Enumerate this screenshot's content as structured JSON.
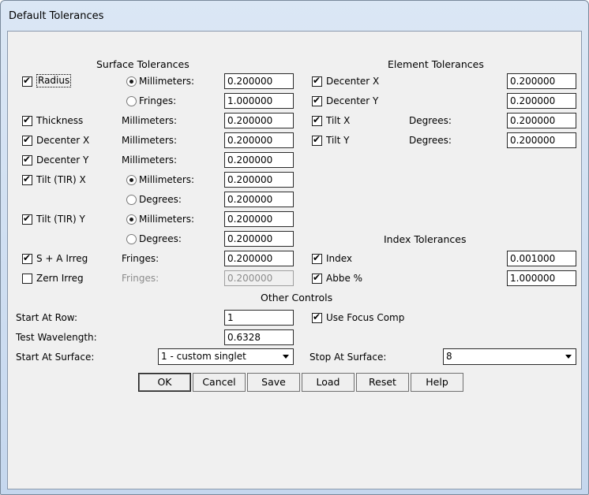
{
  "window": {
    "title": "Default Tolerances"
  },
  "surface": {
    "header": "Surface Tolerances",
    "radius": {
      "label": "Radius",
      "checked": true,
      "opt_mm": "Millimeters:",
      "mm_value": "0.200000",
      "opt_fringes": "Fringes:",
      "fringes_value": "1.000000"
    },
    "thickness": {
      "label": "Thickness",
      "checked": true,
      "unit": "Millimeters:",
      "value": "0.200000"
    },
    "decenter_x": {
      "label": "Decenter X",
      "checked": true,
      "unit": "Millimeters:",
      "value": "0.200000"
    },
    "decenter_y": {
      "label": "Decenter Y",
      "checked": true,
      "unit": "Millimeters:",
      "value": "0.200000"
    },
    "tilt_x": {
      "label": "Tilt (TIR) X",
      "checked": true,
      "opt_mm": "Millimeters:",
      "mm_value": "0.200000",
      "opt_deg": "Degrees:",
      "deg_value": "0.200000"
    },
    "tilt_y": {
      "label": "Tilt (TIR) Y",
      "checked": true,
      "opt_mm": "Millimeters:",
      "mm_value": "0.200000",
      "opt_deg": "Degrees:",
      "deg_value": "0.200000"
    },
    "sa_irreg": {
      "label": "S + A Irreg",
      "checked": true,
      "unit": "Fringes:",
      "value": "0.200000"
    },
    "zern_irreg": {
      "label": "Zern Irreg",
      "checked": false,
      "unit": "Fringes:",
      "value": "0.200000"
    }
  },
  "element": {
    "header": "Element Tolerances",
    "decenter_x": {
      "label": "Decenter X",
      "checked": true,
      "value": "0.200000"
    },
    "decenter_y": {
      "label": "Decenter Y",
      "checked": true,
      "value": "0.200000"
    },
    "tilt_x": {
      "label": "Tilt X",
      "checked": true,
      "unit": "Degrees:",
      "value": "0.200000"
    },
    "tilt_y": {
      "label": "Tilt Y",
      "checked": true,
      "unit": "Degrees:",
      "value": "0.200000"
    }
  },
  "index": {
    "header": "Index Tolerances",
    "index": {
      "label": "Index",
      "checked": true,
      "value": "0.001000"
    },
    "abbe": {
      "label": "Abbe %",
      "checked": true,
      "value": "1.000000"
    }
  },
  "other": {
    "header": "Other Controls",
    "start_row_label": "Start At Row:",
    "start_row_value": "1",
    "use_focus_comp": {
      "label": "Use Focus Comp",
      "checked": true
    },
    "wavelength_label": "Test Wavelength:",
    "wavelength_value": "0.6328",
    "start_surface_label": "Start At Surface:",
    "start_surface_value": "1 - custom singlet",
    "stop_surface_label": "Stop At Surface:",
    "stop_surface_value": "8"
  },
  "buttons": {
    "ok": "OK",
    "cancel": "Cancel",
    "save": "Save",
    "load": "Load",
    "reset": "Reset",
    "help": "Help"
  }
}
